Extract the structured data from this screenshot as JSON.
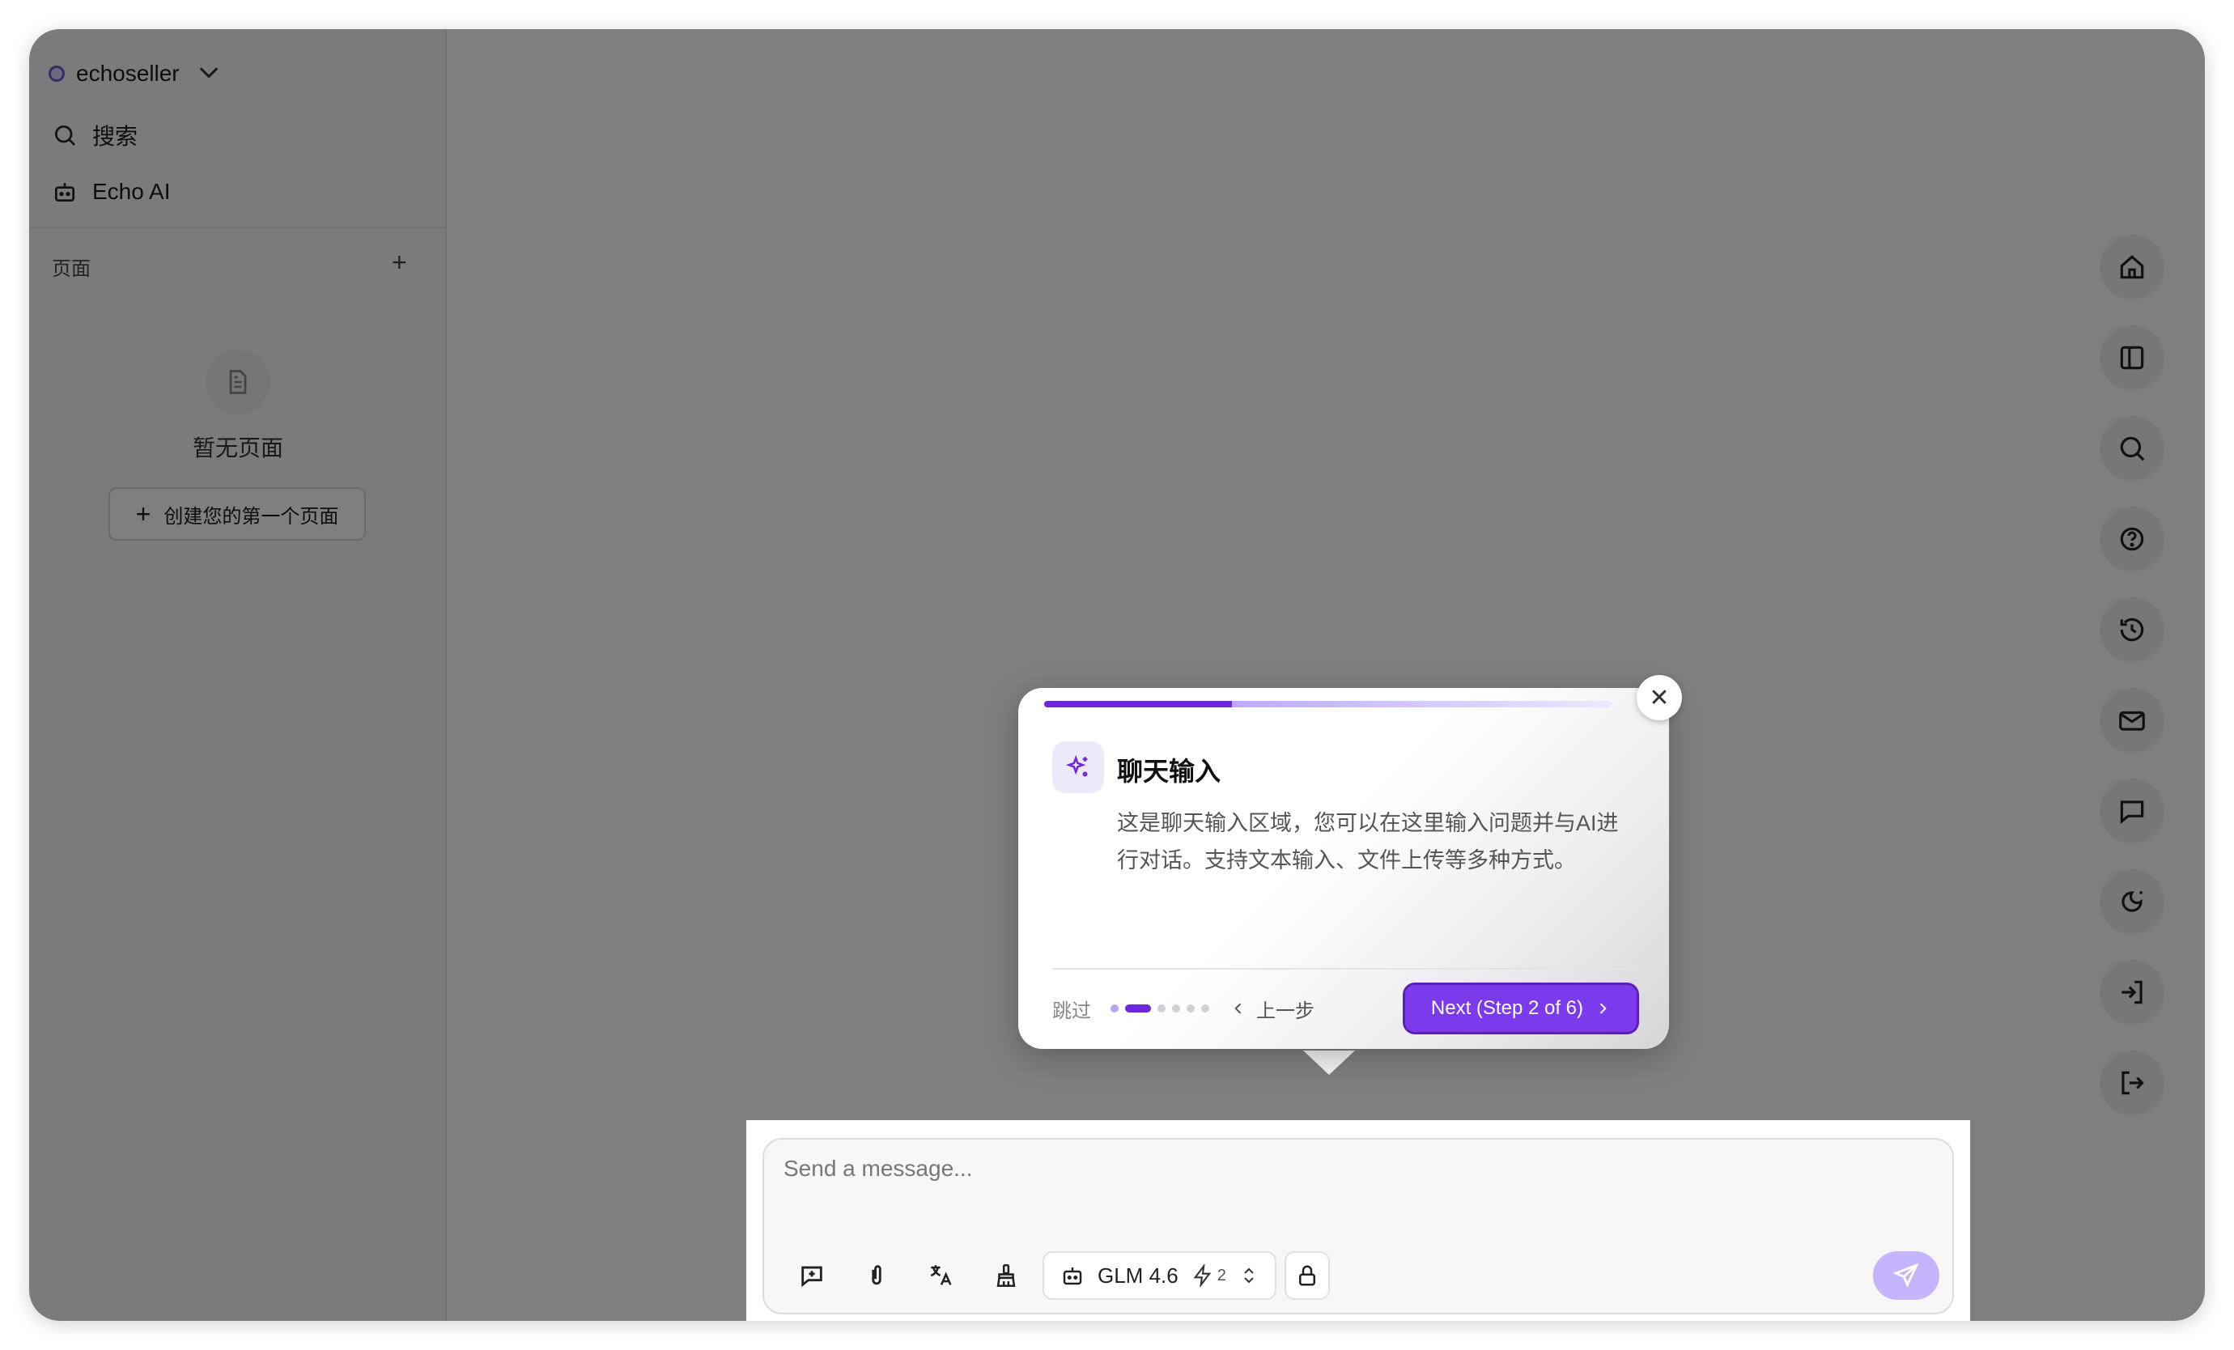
{
  "sidebar": {
    "workspace_name": "echoseller",
    "nav": {
      "search_label": "搜索",
      "ai_label": "Echo AI"
    },
    "pages_section_title": "页面",
    "empty_text": "暂无页面",
    "create_button_label": "创建您的第一个页面"
  },
  "right_rail": {
    "icons": [
      "home-icon",
      "layout-icon",
      "search-icon",
      "help-icon",
      "history-icon",
      "mail-icon",
      "message-icon",
      "theme-icon",
      "login-icon",
      "logout-icon"
    ]
  },
  "tour": {
    "title": "聊天输入",
    "body": "这是聊天输入区域，您可以在这里输入问题并与AI进行对话。支持文本输入、文件上传等多种方式。",
    "skip_label": "跳过",
    "prev_label": "上一步",
    "next_label": "Next (Step 2 of 6)",
    "current_step": 2,
    "total_steps": 6,
    "progress": 0.33,
    "accent_color": "#7c3aed"
  },
  "chat": {
    "placeholder": "Send a message...",
    "model_name": "GLM 4.6",
    "model_count": "2"
  }
}
